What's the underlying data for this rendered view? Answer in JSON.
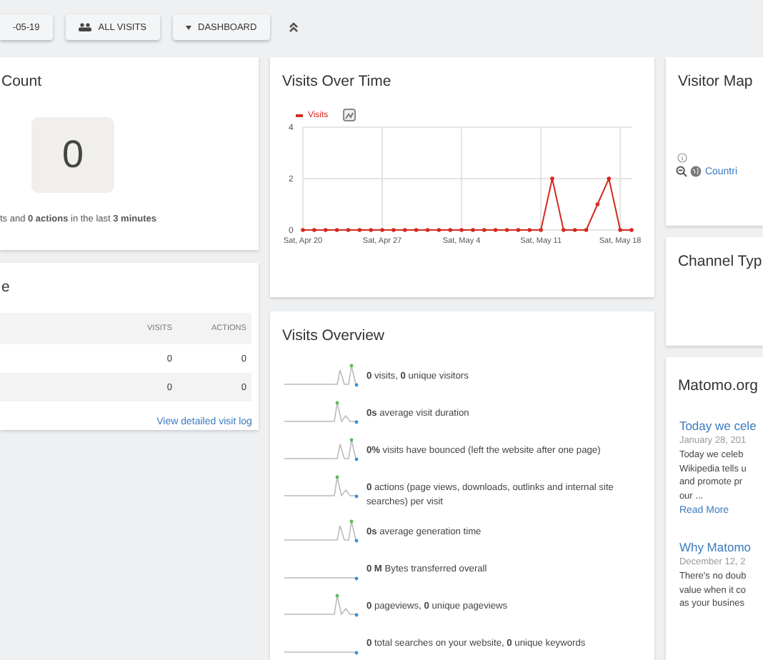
{
  "toolbar": {
    "date_button": "-05-19",
    "segment_button": "ALL VISITS",
    "dashboard_button": "DASHBOARD"
  },
  "real_time": {
    "title": "Count",
    "count": "0",
    "summary": "ts and **0 actions** in the last **3 minutes**"
  },
  "visits_table": {
    "title": "e",
    "columns": [
      "VISITS",
      "ACTIONS"
    ],
    "rows": [
      {
        "visits": "0",
        "actions": "0"
      },
      {
        "visits": "0",
        "actions": "0"
      }
    ],
    "link": "View detailed visit log"
  },
  "visits_over_time": {
    "title": "Visits Over Time",
    "chart_data": {
      "type": "line",
      "grid": true,
      "categories": [
        "Sat, Apr 20",
        null,
        null,
        null,
        null,
        null,
        null,
        "Sat, Apr 27",
        null,
        null,
        null,
        null,
        null,
        null,
        "Sat, May 4",
        null,
        null,
        null,
        null,
        null,
        null,
        "Sat, May 11",
        null,
        null,
        null,
        null,
        null,
        null,
        "Sat, May 18",
        null
      ],
      "series": [
        {
          "name": "Visits",
          "color": "#d4291f",
          "values": [
            0,
            0,
            0,
            0,
            0,
            0,
            0,
            0,
            0,
            0,
            0,
            0,
            0,
            0,
            0,
            0,
            0,
            0,
            0,
            0,
            0,
            0,
            2,
            0,
            0,
            0,
            1,
            2,
            0,
            0
          ]
        }
      ],
      "ylim": [
        0,
        4
      ],
      "yticks": [
        0,
        2,
        4
      ]
    }
  },
  "visits_overview": {
    "title": "Visits Overview",
    "rows": [
      {
        "text": "**0** visits, **0** unique visitors",
        "kind": "double"
      },
      {
        "text": "**0s** average visit duration",
        "kind": "single"
      },
      {
        "text": "**0%** visits have bounced (left the website after one page)",
        "kind": "double"
      },
      {
        "text": "**0** actions (page views, downloads, outlinks and internal site searches) per visit",
        "kind": "single"
      },
      {
        "text": "**0s** average generation time",
        "kind": "double"
      },
      {
        "text": "**0 M** Bytes transferred overall",
        "kind": "flat"
      },
      {
        "text": "**0** pageviews, **0** unique pageviews",
        "kind": "single"
      },
      {
        "text": "**0** total searches on your website, **0** unique keywords",
        "kind": "flat"
      }
    ]
  },
  "visitor_map": {
    "title": "Visitor Map",
    "link": "Countri"
  },
  "channel_type": {
    "title": "Channel Typ"
  },
  "matomo_news": {
    "title": "Matomo.org",
    "posts": [
      {
        "title": "Today we cele",
        "date": "January 28, 201",
        "lines": [
          "Today we celeb",
          "Wikipedia tells u",
          "and promote pr",
          "our ..."
        ],
        "link": "Read More"
      },
      {
        "title": "Why Matomo",
        "date": "December 12, 2",
        "lines": [
          "There's no doub",
          "value when it co",
          "as your busines"
        ]
      }
    ]
  }
}
